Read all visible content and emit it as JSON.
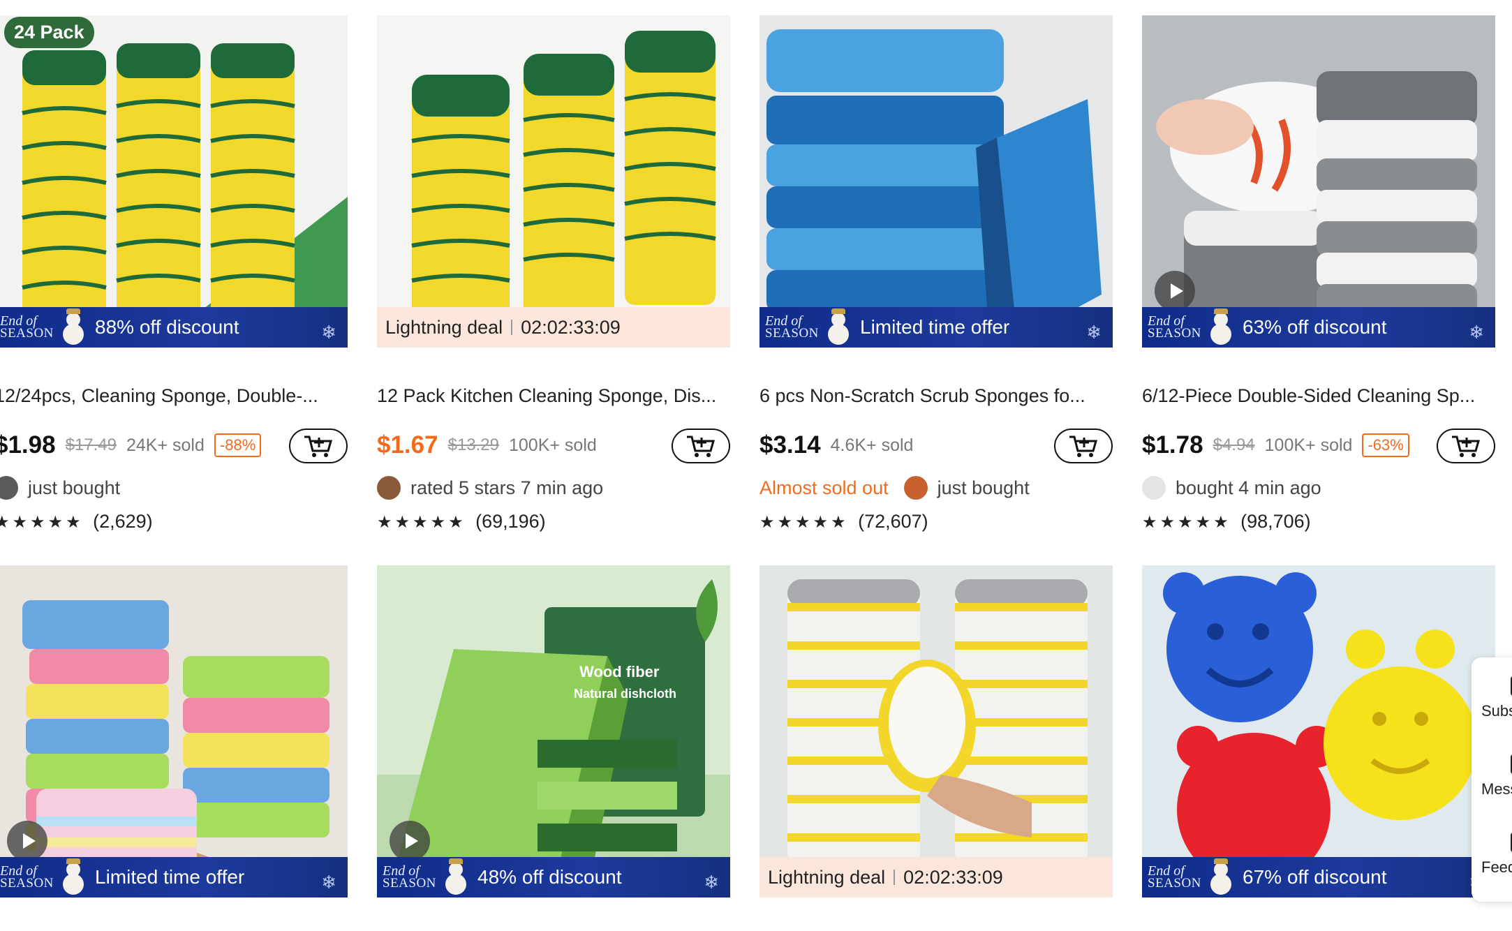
{
  "products": [
    {
      "pack_badge": "24 Pack",
      "banner": {
        "l1": "End of",
        "l2": "SEASON",
        "text": "88% off discount"
      },
      "title": "12/24pcs, Cleaning Sponge, Double-...",
      "price": "$1.98",
      "orig": "$17.49",
      "sold": "24K+ sold",
      "discount": "-88%",
      "social": "just bought",
      "rating_stars": "★★★★★",
      "rating_count": "(2,629)"
    },
    {
      "deal": {
        "label": "Lightning deal",
        "time": "02:02:33:09"
      },
      "title": "12 Pack Kitchen Cleaning Sponge, Dis...",
      "price": "$1.67",
      "orig": "$13.29",
      "sold": "100K+ sold",
      "social": "rated 5 stars 7 min ago",
      "rating_stars": "★★★★★",
      "rating_count": "(69,196)"
    },
    {
      "banner": {
        "l1": "End of",
        "l2": "SEASON",
        "text": "Limited time offer"
      },
      "title": "6 pcs Non-Scratch Scrub Sponges fo...",
      "price": "$3.14",
      "sold": "4.6K+ sold",
      "alert": "Almost sold out",
      "social": "just bought",
      "rating_stars": "★★★★★",
      "rating_count": "(72,607)"
    },
    {
      "banner": {
        "l1": "End of",
        "l2": "SEASON",
        "text": "63% off discount"
      },
      "title": "6/12-Piece Double-Sided Cleaning Sp...",
      "price": "$1.78",
      "orig": "$4.94",
      "sold": "100K+ sold",
      "discount": "-63%",
      "social": "bought 4 min ago",
      "rating_stars": "★★★★★",
      "rating_count": "(98,706)"
    },
    {
      "banner": {
        "l1": "End of",
        "l2": "SEASON",
        "text": "Limited time offer"
      }
    },
    {
      "banner": {
        "l1": "End of",
        "l2": "SEASON",
        "text": "48% off discount"
      },
      "pack_text": {
        "l1": "Wood fiber",
        "l2": "Natural dishcloth"
      }
    },
    {
      "deal": {
        "label": "Lightning deal",
        "time": "02:02:33:09"
      }
    },
    {
      "banner": {
        "l1": "End of",
        "l2": "SEASON",
        "text": "67% off discount"
      }
    }
  ],
  "side_panel": {
    "items": [
      "Subs",
      "Mess",
      "Feed"
    ]
  },
  "colors": {
    "accent": "#f26b1d",
    "banner_blue": "#1d3a9c"
  }
}
